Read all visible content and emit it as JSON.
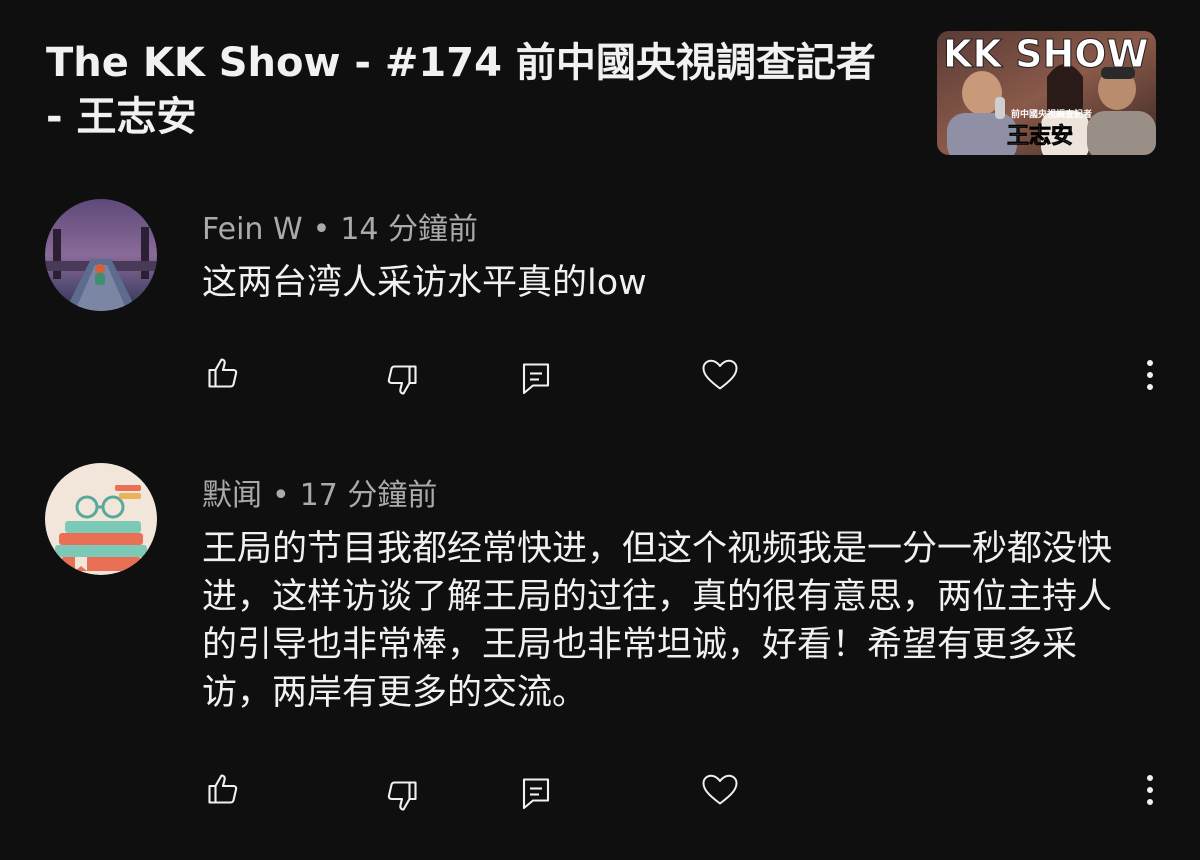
{
  "video": {
    "title": "The KK Show - #174 前中國央視調查記者 - 王志安",
    "thumbnail": {
      "banner_text": "KK SHOW",
      "caption_small": "前中國央視調查記者",
      "caption_large": "王志安"
    }
  },
  "comments": [
    {
      "author": "Fein W",
      "separator": "•",
      "time": "14 分鐘前",
      "text": "这两台湾人采访水平真的low"
    },
    {
      "author": "默闻",
      "separator": "•",
      "time": "17 分鐘前",
      "text": "王局的节目我都经常快进，但这个视频我是一分一秒都没快进，这样访谈了解王局的过往，真的很有意思，两位主持人的引导也非常棒，王局也非常坦诚，好看！希望有更多采访，两岸有更多的交流。"
    }
  ],
  "icons": {
    "like": "thumbs-up-icon",
    "dislike": "thumbs-down-icon",
    "reply": "reply-comment-icon",
    "heart": "heart-icon",
    "more": "more-vertical-icon"
  },
  "colors": {
    "background": "#0f0f0f",
    "primary_text": "#f1f1f1",
    "secondary_text": "#aaaaaa"
  }
}
